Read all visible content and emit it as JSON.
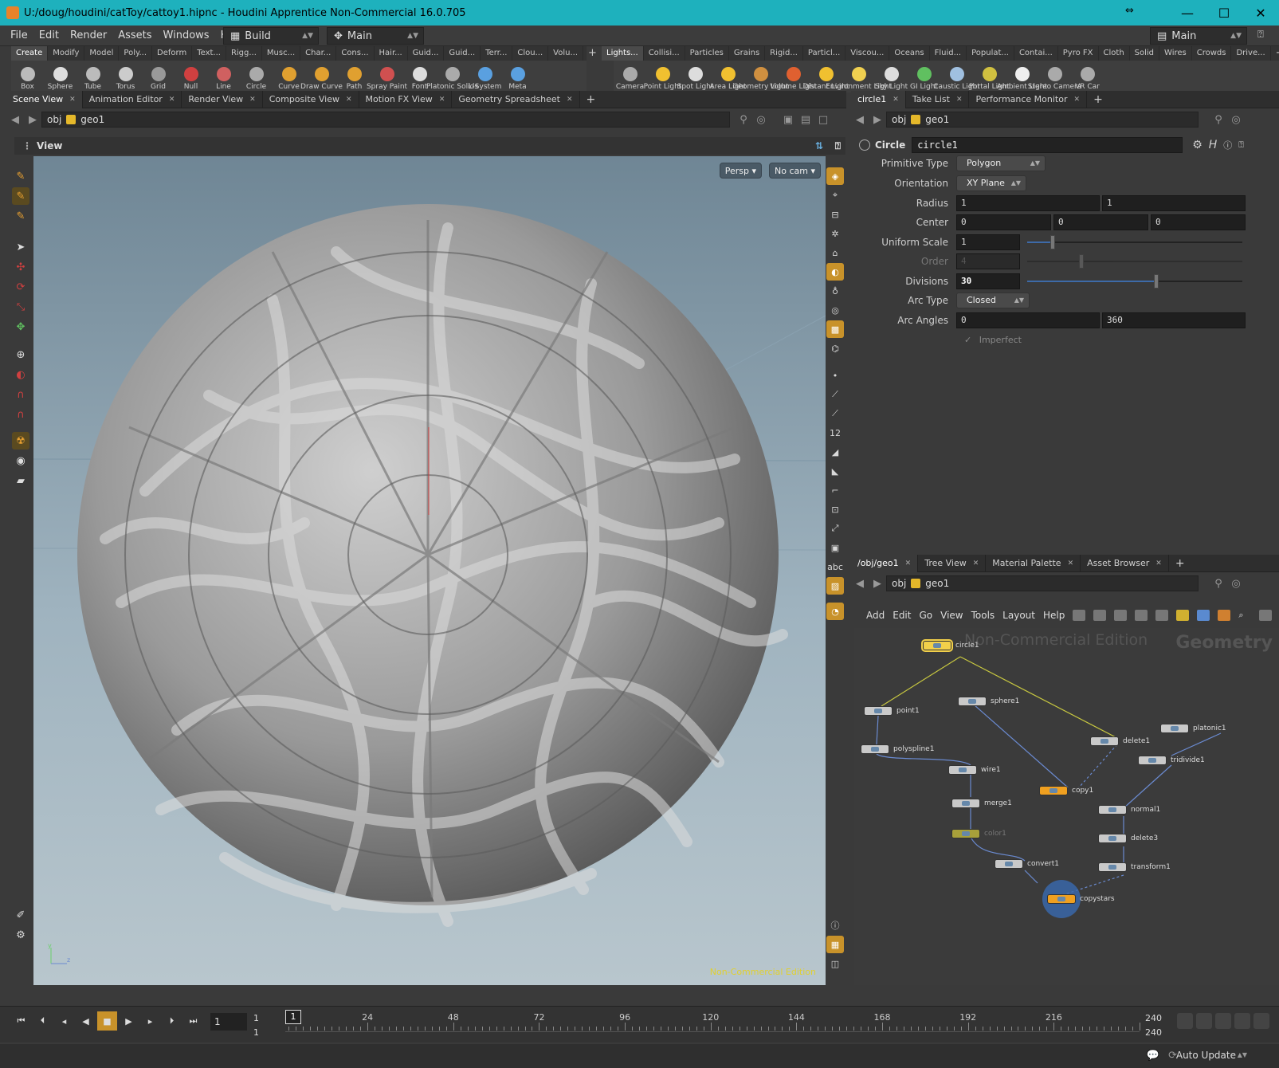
{
  "window": {
    "title": "U:/doug/houdini/catToy/cattoy1.hipnc - Houdini Apprentice Non-Commercial 16.0.705",
    "minimize": "—",
    "maximize": "☐",
    "close": "✕",
    "resize_glyph": "⇔"
  },
  "menubar": {
    "items": [
      "File",
      "Edit",
      "Render",
      "Assets",
      "Windows",
      "Help"
    ],
    "desktop": "Build",
    "desktop2": "Main",
    "desktop_right": "Main"
  },
  "shelf_left": {
    "tabs": [
      "Create",
      "Modify",
      "Model",
      "Poly...",
      "Deform",
      "Text...",
      "Rigg...",
      "Musc...",
      "Char...",
      "Cons...",
      "Hair...",
      "Guid...",
      "Guid...",
      "Terr...",
      "Clou...",
      "Volu..."
    ],
    "tools": [
      {
        "label": "Box",
        "color": "#bbbbbb"
      },
      {
        "label": "Sphere",
        "color": "#dddddd"
      },
      {
        "label": "Tube",
        "color": "#bbbbbb"
      },
      {
        "label": "Torus",
        "color": "#cccccc"
      },
      {
        "label": "Grid",
        "color": "#999999"
      },
      {
        "label": "Null",
        "color": "#d04040"
      },
      {
        "label": "Line",
        "color": "#d06060"
      },
      {
        "label": "Circle",
        "color": "#aaaaaa"
      },
      {
        "label": "Curve",
        "color": "#e0a030"
      },
      {
        "label": "Draw Curve",
        "color": "#e0a030"
      },
      {
        "label": "Path",
        "color": "#e0a030"
      },
      {
        "label": "Spray Paint",
        "color": "#d05050"
      },
      {
        "label": "Font",
        "color": "#dddddd"
      },
      {
        "label": "Platonic Solids",
        "color": "#aaaaaa"
      },
      {
        "label": "L-System",
        "color": "#5aa0e0"
      },
      {
        "label": "Meta",
        "color": "#5aa0e0"
      }
    ]
  },
  "shelf_right": {
    "tabs": [
      "Lights...",
      "Collisi...",
      "Particles",
      "Grains",
      "Rigid...",
      "Particl...",
      "Viscou...",
      "Oceans",
      "Fluid...",
      "Populat...",
      "Contai...",
      "Pyro FX",
      "Cloth",
      "Solid",
      "Wires",
      "Crowds",
      "Drive..."
    ],
    "tools": [
      {
        "label": "Camera",
        "color": "#aaaaaa"
      },
      {
        "label": "Point Light",
        "color": "#f0c030"
      },
      {
        "label": "Spot Light",
        "color": "#dddddd"
      },
      {
        "label": "Area Light",
        "color": "#f0c030"
      },
      {
        "label": "Geometry Light",
        "color": "#d09040"
      },
      {
        "label": "Volume Light",
        "color": "#e06030"
      },
      {
        "label": "Distant Light",
        "color": "#f0c030"
      },
      {
        "label": "Environment Light",
        "color": "#f0d050"
      },
      {
        "label": "Sky Light",
        "color": "#dddddd"
      },
      {
        "label": "GI Light",
        "color": "#60c060"
      },
      {
        "label": "Caustic Light",
        "color": "#a0c0e0"
      },
      {
        "label": "Portal Light",
        "color": "#d0c040"
      },
      {
        "label": "Ambient Light",
        "color": "#eeeeee"
      },
      {
        "label": "Stereo Camera",
        "color": "#aaaaaa"
      },
      {
        "label": "VR Car",
        "color": "#aaaaaa"
      }
    ]
  },
  "left_pane": {
    "tabs": [
      "Scene View",
      "Animation Editor",
      "Render View",
      "Composite View",
      "Motion FX View",
      "Geometry Spreadsheet"
    ],
    "path": [
      "obj",
      "geo1"
    ],
    "header": "View",
    "persp_button": "Persp ▾",
    "cam_button": "No cam ▾",
    "nc_label": "Non-Commercial Edition"
  },
  "param_pane": {
    "tabs": [
      "circle1",
      "Take List",
      "Performance Monitor"
    ],
    "path": [
      "obj",
      "geo1"
    ],
    "node_type": "Circle",
    "node_name": "circle1",
    "primitive_type_label": "Primitive Type",
    "primitive_type": "Polygon",
    "orientation_label": "Orientation",
    "orientation": "XY Plane",
    "radius_label": "Radius",
    "radius": [
      "1",
      "1"
    ],
    "center_label": "Center",
    "center": [
      "0",
      "0",
      "0"
    ],
    "uniform_scale_label": "Uniform Scale",
    "uniform_scale": "1",
    "uniform_scale_slider": 0.12,
    "order_label": "Order",
    "order": "4",
    "order_slider": 0.25,
    "divisions_label": "Divisions",
    "divisions": "30",
    "divisions_slider": 0.6,
    "arc_type_label": "Arc Type",
    "arc_type": "Closed",
    "arc_angles_label": "Arc Angles",
    "arc_angles": [
      "0",
      "360"
    ],
    "imperfect_label": "Imperfect"
  },
  "network_pane": {
    "tabs": [
      "/obj/geo1",
      "Tree View",
      "Material Palette",
      "Asset Browser"
    ],
    "path": [
      "obj",
      "geo1"
    ],
    "menu": [
      "Add",
      "Edit",
      "Go",
      "View",
      "Tools",
      "Layout",
      "Help"
    ],
    "watermark": "Non-Commercial Edition",
    "context": "Geometry",
    "nodes": {
      "circle1": "circle1",
      "point1": "point1",
      "sphere1": "sphere1",
      "delete1": "delete1",
      "platonic1": "platonic1",
      "polyspline1": "polyspline1",
      "wire1": "wire1",
      "tridivide1": "tridivide1",
      "copy1": "copy1",
      "merge1": "merge1",
      "normal1": "normal1",
      "color1": "color1",
      "delete3": "delete3",
      "convert1": "convert1",
      "transform1": "transform1",
      "copystars": "copystars"
    }
  },
  "timeline": {
    "current_frame": "1",
    "range_start_top": "1",
    "range_start_bottom": "1",
    "ruler_frame": "1",
    "ticks": [
      "24",
      "48",
      "72",
      "96",
      "120",
      "144",
      "168",
      "192",
      "216"
    ],
    "range_end_top": "240",
    "range_end_bottom": "240"
  },
  "status": {
    "auto_update": "Auto Update"
  }
}
